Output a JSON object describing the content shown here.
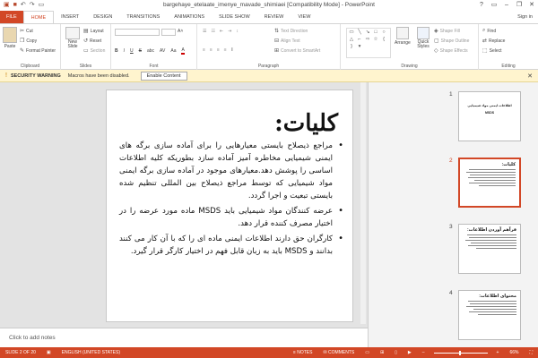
{
  "window": {
    "title": "bargehaye_etelaate_imenye_mavade_shimiaei [Compatibility Mode] - PowerPoint",
    "help": "?",
    "minimize": "–",
    "restore": "❐",
    "close": "✕"
  },
  "tabs": [
    "FILE",
    "HOME",
    "INSERT",
    "DESIGN",
    "TRANSITIONS",
    "ANIMATIONS",
    "SLIDE SHOW",
    "REVIEW",
    "VIEW"
  ],
  "active_tab": "HOME",
  "sign_in": "Sign in",
  "ribbon": {
    "clipboard": {
      "label": "Clipboard",
      "paste": "Paste",
      "cut": "Cut",
      "copy": "Copy",
      "format_painter": "Format Painter"
    },
    "slides": {
      "label": "Slides",
      "new_slide": "New Slide",
      "layout": "Layout",
      "reset": "Reset",
      "section": "Section"
    },
    "font": {
      "label": "Font",
      "bold": "B",
      "italic": "I",
      "underline": "U",
      "strike": "S",
      "shadow": "abc",
      "spacing": "AV",
      "case": "Aa",
      "color": "A"
    },
    "paragraph": {
      "label": "Paragraph",
      "text_direction": "Text Direction",
      "align_text": "Align Text",
      "convert_smartart": "Convert to SmartArt"
    },
    "drawing": {
      "label": "Drawing",
      "arrange": "Arrange",
      "quick_styles": "Quick Styles",
      "shape_fill": "Shape Fill",
      "shape_outline": "Shape Outline",
      "shape_effects": "Shape Effects"
    },
    "editing": {
      "label": "Editing",
      "find": "Find",
      "replace": "Replace",
      "select": "Select"
    }
  },
  "security_bar": {
    "title": "SECURITY WARNING",
    "message": "Macros have been disabled.",
    "button": "Enable Content",
    "close": "✕"
  },
  "slide": {
    "title": "کلیات:",
    "bullets": [
      "مراجع ذیصلاح بایستی معیارهایی را برای آماده سازی برگه های ایمنی شیمیایی مخاطره آمیز آماده سازد بطوریکه کلیه اطلاعات اساسی را پوشش دهد.معیارهای موجود در آماده سازی برگه ایمنی مواد شیمیایی که توسط مراجع ذیصلاح بین المللی تنظیم شده بایستی تبعیت و اجرا گردد.",
      "عرضه کنندگان مواد شیمیایی باید MSDS ماده مورد عرضه را در اختیار مصرف کننده قرار دهد.",
      "کارگران حق دارند اطلاعات ایمنی ماده ای را که با آن کار می کنند بدانند و MSDS باید به زبان قابل فهم در اختیار کارگر قرار گیرد."
    ]
  },
  "notes_placeholder": "Click to add notes",
  "thumbnails": [
    {
      "num": "1",
      "title": "اطلاعات ایمنی مواد شیمیایی",
      "sub": "MSDS"
    },
    {
      "num": "2",
      "head": "کلیات:"
    },
    {
      "num": "3",
      "head": "فرآهم آوردن اطلاعات:"
    },
    {
      "num": "4",
      "head": "محتوای اطلاعات:"
    }
  ],
  "status": {
    "slide": "SLIDE 2 OF 20",
    "language": "ENGLISH (UNITED STATES)",
    "notes": "NOTES",
    "comments": "COMMENTS",
    "zoom": "66%"
  },
  "colors": {
    "accent": "#d24726",
    "security_bg": "#fff4ce"
  }
}
